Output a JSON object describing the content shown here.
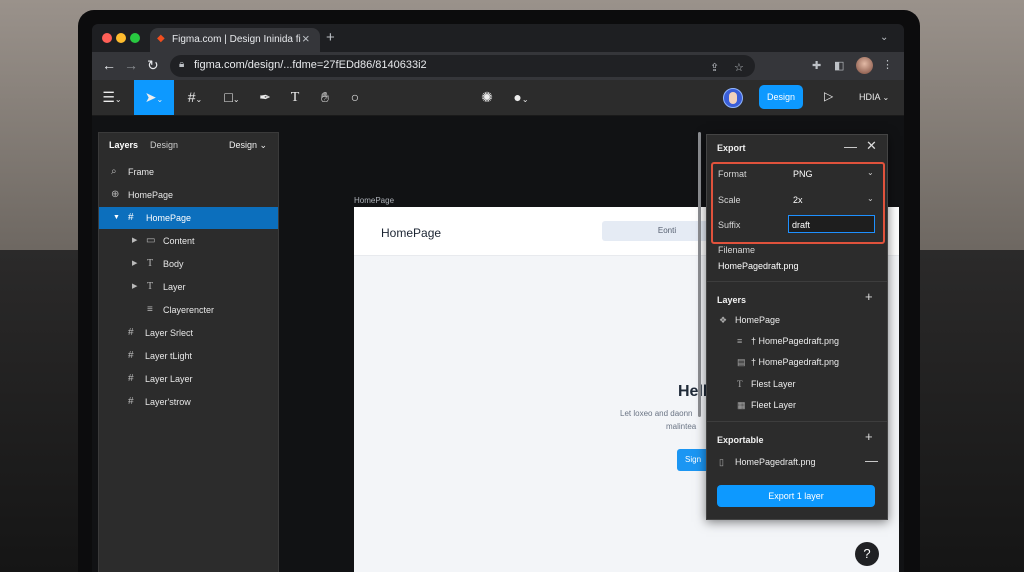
{
  "browser": {
    "tab_title": "Figma.com | Design Ininida fi",
    "url": "figma.com/design/...fdme=27fEDd86/8140633i2"
  },
  "figma": {
    "design_button": "Design",
    "zoom_label": "HDIA"
  },
  "layers_panel": {
    "tabs": [
      "Layers",
      "Design"
    ],
    "page_label": "Design",
    "search": "Frame",
    "items": [
      {
        "label": "HomePage",
        "icon": "globe-icon"
      },
      {
        "label": "HomePage",
        "icon": "frame-icon"
      },
      {
        "label": "Content",
        "icon": "folder-icon"
      },
      {
        "label": "Body",
        "icon": "text-icon"
      },
      {
        "label": "Layer",
        "icon": "text-icon"
      },
      {
        "label": "Clayerencter",
        "icon": "lines-icon"
      },
      {
        "label": "Layer Srlect",
        "icon": "frame-icon"
      },
      {
        "label": "Layer tLight",
        "icon": "frame-icon"
      },
      {
        "label": "Layer Layer",
        "icon": "frame-icon"
      },
      {
        "label": "Layer'strow",
        "icon": "frame-icon"
      }
    ]
  },
  "canvas": {
    "frame_label": "HomePage",
    "logo": "HomePage",
    "nav_pill": "Eonti",
    "hero_title": "Hell",
    "hero_line1": "Let loxeo and daonn",
    "hero_line2": "malintea",
    "cta": "Sign"
  },
  "export_panel": {
    "title": "Export",
    "format_label": "Format",
    "format_value": "PNG",
    "scale_label": "Scale",
    "scale_value": "2x",
    "suffix_label": "Suffix",
    "suffix_value": "draft",
    "filename_label": "Filename",
    "filename_value": "HomePagedraft.png",
    "layers_title": "Layers",
    "layers": [
      {
        "label": "HomePage"
      },
      {
        "label": "† HomePagedraft.png"
      },
      {
        "label": "† HomePagedraft.png"
      },
      {
        "label": "Flest Layer"
      },
      {
        "label": "Fleet Layer"
      }
    ],
    "exportable_title": "Exportable",
    "exportable_file": "HomePagedraft.png",
    "export_button": "Export 1 layer"
  },
  "colors": {
    "accent": "#0d99ff",
    "highlight": "#e0523c"
  }
}
